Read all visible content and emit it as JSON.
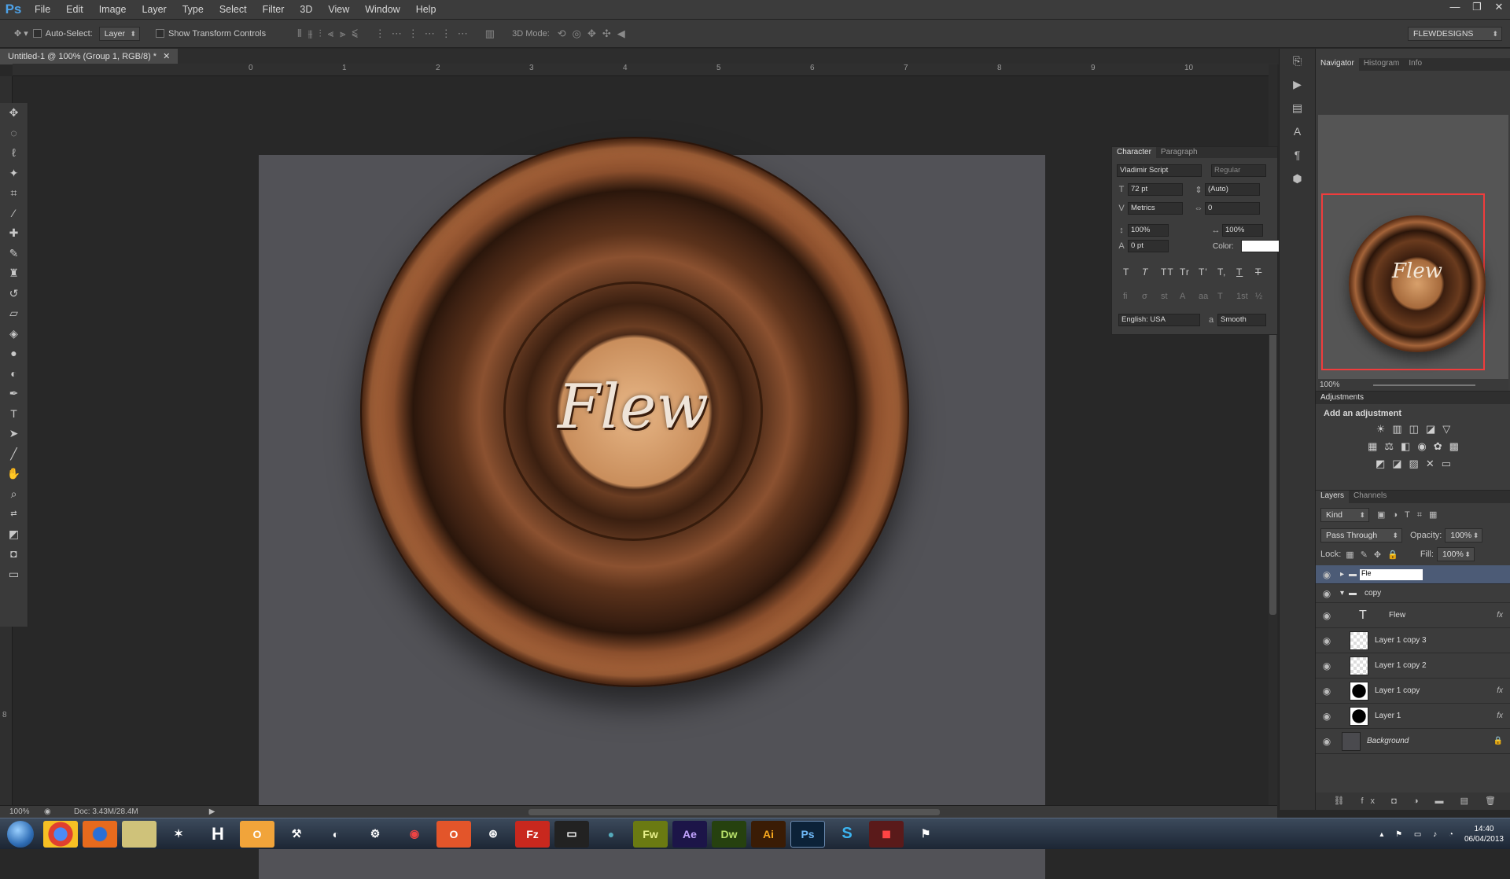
{
  "app": {
    "logo": "Ps",
    "menu": [
      "File",
      "Edit",
      "Image",
      "Layer",
      "Type",
      "Select",
      "Filter",
      "3D",
      "View",
      "Window",
      "Help"
    ],
    "workspace": "FLEWDESIGNS"
  },
  "options": {
    "auto_select": "Auto-Select:",
    "auto_select_value": "Layer",
    "show_transform": "Show Transform Controls",
    "mode3d": "3D Mode:"
  },
  "document": {
    "tab": "Untitled-1 @ 100% (Group 1, RGB/8) *",
    "zoom": "100%",
    "doc_size": "Doc: 3.43M/28.4M",
    "artwork_text": "Flew"
  },
  "ruler": {
    "ticks": [
      "0",
      "1",
      "2",
      "3",
      "4",
      "5",
      "6",
      "7",
      "8",
      "9",
      "10"
    ],
    "left_mark": "8"
  },
  "character": {
    "tabs": [
      "Character",
      "Paragraph"
    ],
    "font": "Vladimir Script",
    "style": "Regular",
    "size": "72 pt",
    "leading": "(Auto)",
    "kerning": "Metrics",
    "tracking": "0",
    "vscale": "100%",
    "hscale": "100%",
    "baseline": "0 pt",
    "color_label": "Color:",
    "color": "#ffffff",
    "language": "English: USA",
    "antialias": "Smooth",
    "styles": [
      "T",
      "T",
      "TT",
      "Tr",
      "T'",
      "T,",
      "T",
      "T"
    ],
    "opentype": [
      "fi",
      "σ",
      "st",
      "A",
      "aa",
      "T",
      "1st",
      "½"
    ]
  },
  "navigator": {
    "tabs": [
      "Navigator",
      "Histogram",
      "Info"
    ],
    "zoom": "100%",
    "preview_text": "Flew"
  },
  "adjustments": {
    "title": "Adjustments",
    "subtitle": "Add an adjustment"
  },
  "layers": {
    "tabs": [
      "Layers",
      "Channels"
    ],
    "kind": "Kind",
    "blend": "Pass Through",
    "opacity_label": "Opacity:",
    "opacity": "100%",
    "lock_label": "Lock:",
    "fill_label": "Fill:",
    "fill": "100%",
    "items": [
      "Flew",
      "copy",
      "Flew",
      "Layer 1 copy 3",
      "Layer 1 copy 2",
      "Layer 1 copy",
      "Layer 1",
      "Background"
    ],
    "editing_text": "Fle"
  },
  "taskbar": {
    "apps": [
      "Chrome",
      "Firefox",
      "Files",
      "Sketch",
      "H",
      "Outlook",
      "Tools",
      "Obs",
      "Steam",
      "Camera",
      "Opera",
      "Cinema",
      "Fz",
      "Term",
      "Sphere",
      "Fw",
      "Ae",
      "Dw",
      "Ai",
      "Ps",
      "S",
      "Rec",
      "Misc"
    ],
    "time": "14:40",
    "date": "06/04/2013"
  }
}
